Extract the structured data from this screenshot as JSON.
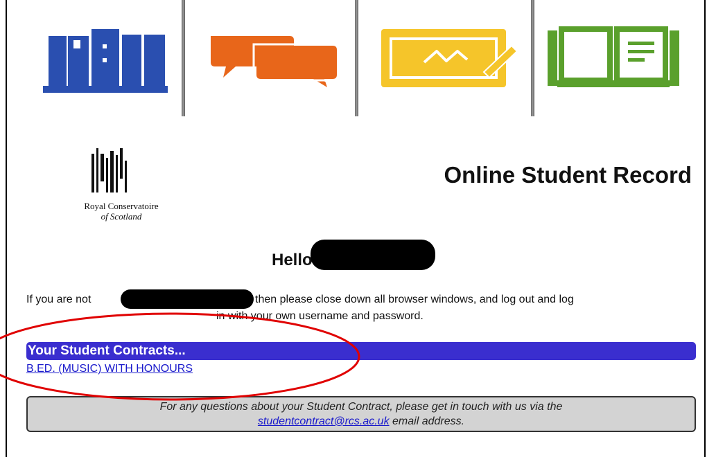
{
  "header": {
    "icons": [
      "bookshelf-icon",
      "speech-bubbles-icon",
      "tablet-pen-icon",
      "open-book-icon"
    ],
    "colors": {
      "blue": "#2a4fb0",
      "orange": "#e8661a",
      "yellow": "#f5c52a",
      "green": "#5aa02c"
    }
  },
  "logo": {
    "line1": "Royal Conservatoire",
    "line2": "of Scotland"
  },
  "page_title": "Online Student Record",
  "greeting": {
    "prefix": "Hello",
    "suffix": ","
  },
  "notice": {
    "part1": "If you are not",
    "part2": "then please close down all browser windows, and log out and log",
    "part3": "in with your own username and password."
  },
  "contracts": {
    "heading": "Your Student Contracts...",
    "items": [
      "B.ED. (MUSIC) WITH HONOURS"
    ]
  },
  "info": {
    "line1": "For any questions about your Student Contract, please get in touch with us via the",
    "email": "studentcontract@rcs.ac.uk",
    "line2_suffix": " email address."
  },
  "colors": {
    "contracts_bar": "#3a2ecf",
    "link": "#1a1acc",
    "info_box": "#d3d3d3",
    "highlight_circle": "#e00000"
  }
}
